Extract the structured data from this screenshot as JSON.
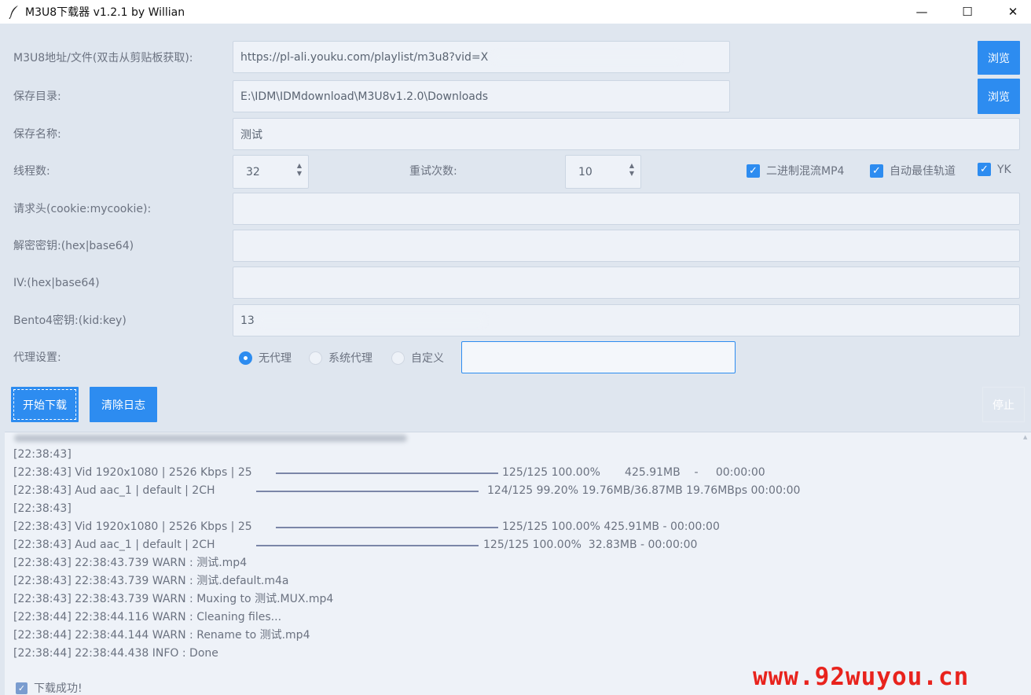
{
  "window": {
    "title": "M3U8下载器 v1.2.1 by Willian",
    "minimize": "—",
    "maximize": "☐",
    "close": "✕"
  },
  "form": {
    "url_label": "M3U8地址/文件(双击从剪贴板获取):",
    "url_value": "https://pl-ali.youku.com/playlist/m3u8?vid=X",
    "browse_label": "浏览",
    "save_dir_label": "保存目录:",
    "save_dir_value": "E:\\IDM\\IDMdownload\\M3U8v1.2.0\\Downloads",
    "browse2_label": "浏览",
    "save_name_label": "保存名称:",
    "save_name_value": "测试",
    "threads_label": "线程数:",
    "threads_value": "32",
    "retry_label": "重试次数:",
    "retry_value": "10",
    "headers_label": "请求头(cookie:mycookie):",
    "headers_value": "",
    "key_label": "解密密钥:(hex|base64)",
    "key_value": "",
    "iv_label": "IV:(hex|base64)",
    "iv_value": "",
    "bento_label": "Bento4密钥:(kid:key)",
    "bento_value": "13",
    "proxy_label": "代理设置:",
    "proxy_custom_value": ""
  },
  "checks": {
    "binary_mux": "二进制混流MP4",
    "auto_track": "自动最佳轨道",
    "yk": "YK",
    "check_glyph": "✓"
  },
  "proxy_options": {
    "none": "无代理",
    "system": "系统代理",
    "custom": "自定义",
    "selected": "none"
  },
  "buttons": {
    "start": "开始下载",
    "clear_log": "清除日志",
    "stop": "停止"
  },
  "log": [
    "[22:38:43]",
    "[22:38:43] Vid 1920x1080 | 2526 Kbps | 25",
    "[22:38:43] Aud aac_1 | default | 2CH",
    "[22:38:43]",
    "[22:38:43] Vid 1920x1080 | 2526 Kbps | 25",
    "[22:38:43] Aud aac_1 | default | 2CH",
    "[22:38:43] 22:38:43.739 WARN : 测试.mp4",
    "[22:38:43] 22:38:43.739 WARN : 测试.default.m4a",
    "[22:38:43] 22:38:43.739 WARN : Muxing to 测试.MUX.mp4",
    "[22:38:44] 22:38:44.116 WARN : Cleaning files...",
    "[22:38:44] 22:38:44.144 WARN : Rename to 测试.mp4",
    "[22:38:44] 22:38:44.438 INFO : Done"
  ],
  "log_progress": {
    "vid1": "125/125 100.00%       425.91MB    -     00:00:00",
    "aud1": "124/125 99.20% 19.76MB/36.87MB 19.76MBps 00:00:00",
    "vid2": "125/125 100.00% 425.91MB - 00:00:00",
    "aud2": "125/125 100.00%  32.83MB - 00:00:00"
  },
  "status": {
    "success": "下载成功!"
  },
  "watermark": "www.92wuyou.cn",
  "colors": {
    "accent": "#2d8cf0",
    "background": "#dfe6ef",
    "watermark": "#e8231d"
  }
}
